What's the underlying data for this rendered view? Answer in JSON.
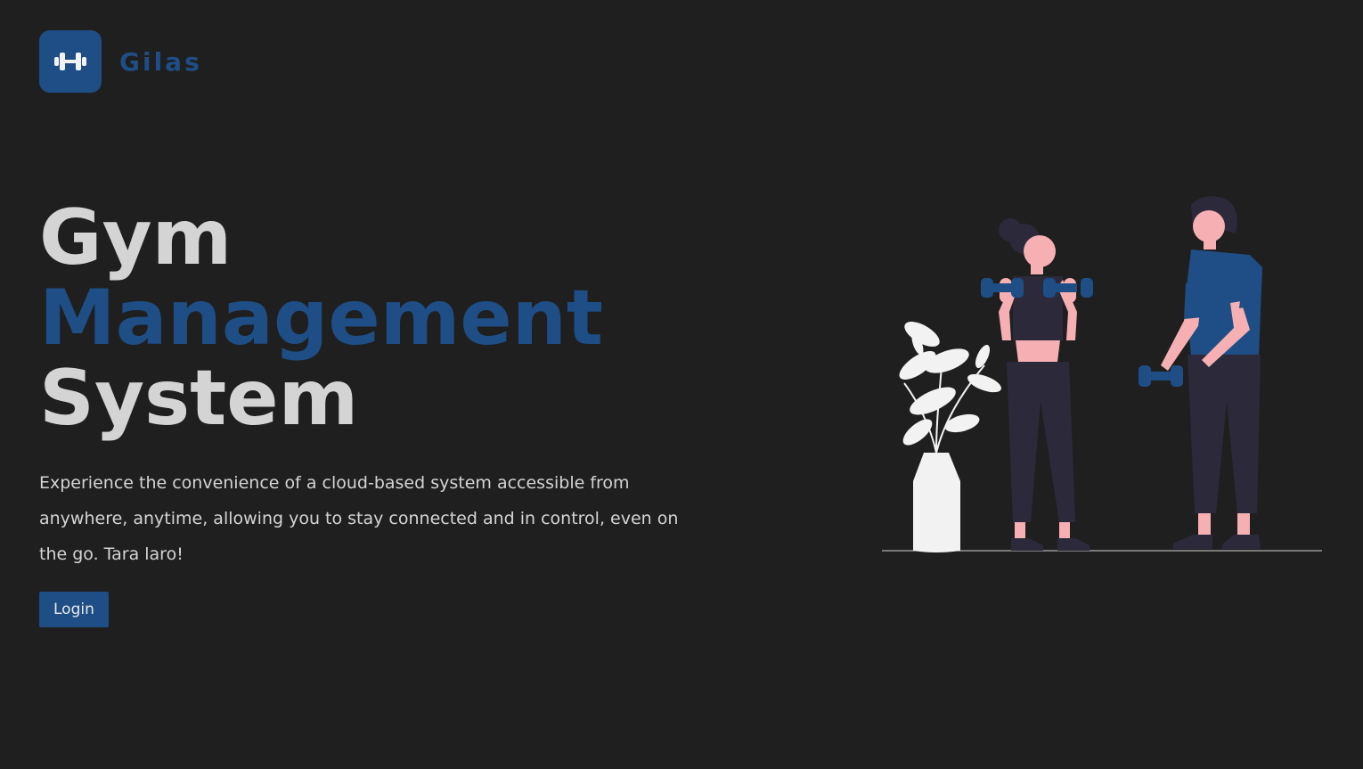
{
  "brand": {
    "name": "Gilas",
    "logo_icon": "dumbbell-icon"
  },
  "hero": {
    "title_part1": "Gym ",
    "title_accent": "Management",
    "title_part2": "System",
    "description": "Experience the convenience of a cloud-based system accessible from anywhere, anytime, allowing you to stay connected and in control, even on the go. Tara laro!",
    "login_label": "Login"
  },
  "colors": {
    "background": "#1f1f1f",
    "accent": "#1e4e85",
    "text": "#d4d4d4",
    "skin": "#f6b0b4",
    "dark_clothing": "#2c2a3a",
    "plant": "#f2f2f2"
  },
  "illustration": {
    "icon": "people-exercising-illustration"
  }
}
